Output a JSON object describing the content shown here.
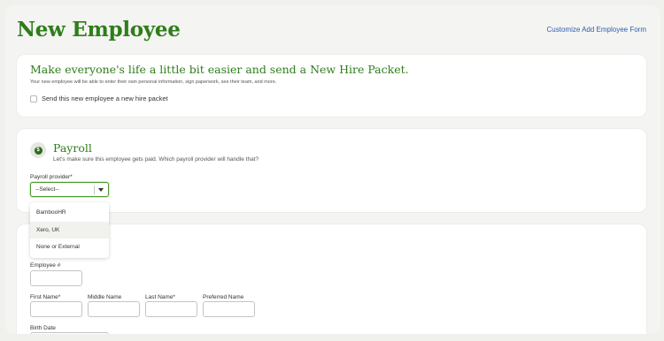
{
  "page": {
    "title": "New Employee",
    "customize_link": "Customize Add Employee Form"
  },
  "hire_packet": {
    "heading": "Make everyone's life a little bit easier and send a New Hire Packet.",
    "subtitle": "Your new employee will be able to enter their own personal information, sign paperwork, see their team, and more.",
    "checkbox_label": "Send this new employee a new hire packet",
    "checked": false
  },
  "payroll": {
    "icon": "dollar-icon",
    "heading": "Payroll",
    "subtitle": "Let's make sure this employee gets paid. Which payroll provider will handle that?",
    "provider_label": "Payroll provider*",
    "selected": "--Select--",
    "options": [
      "BambooHR",
      "Xero, UK",
      "None or External"
    ]
  },
  "basic_info": {
    "employee_number_label": "Employee #",
    "first_name_label": "First Name*",
    "middle_name_label": "Middle Name",
    "last_name_label": "Last Name*",
    "preferred_name_label": "Preferred Name",
    "birth_date_label": "Birth Date"
  },
  "colors": {
    "accent_green": "#2e7d1a",
    "link_blue": "#2d5fb0",
    "background": "#f0f0ed"
  }
}
